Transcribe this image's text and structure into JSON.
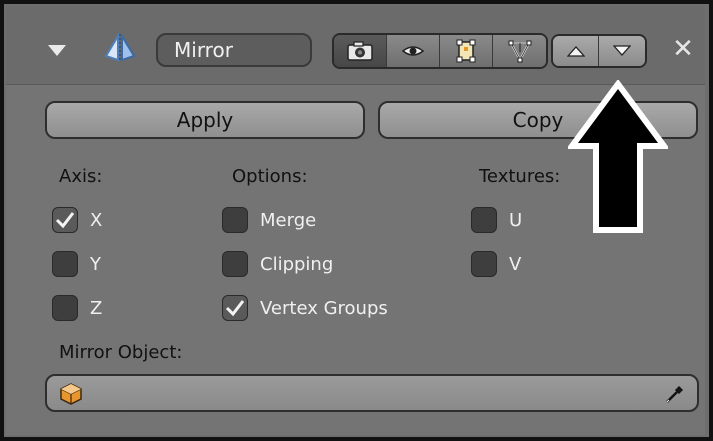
{
  "header": {
    "modifier_name": "Mirror",
    "toggles": [
      {
        "icon": "camera-icon",
        "active": true
      },
      {
        "icon": "eye-icon",
        "active": false
      },
      {
        "icon": "editmode-icon",
        "active": false
      },
      {
        "icon": "vertex-cage-icon",
        "active": false
      }
    ],
    "move_buttons": [
      "move-up-icon",
      "move-down-icon"
    ],
    "close": "✕"
  },
  "actions": {
    "apply_label": "Apply",
    "copy_label": "Copy"
  },
  "columns": {
    "axis": {
      "label": "Axis:",
      "items": [
        {
          "label": "X",
          "checked": true
        },
        {
          "label": "Y",
          "checked": false
        },
        {
          "label": "Z",
          "checked": false
        }
      ]
    },
    "options": {
      "label": "Options:",
      "items": [
        {
          "label": "Merge",
          "checked": false
        },
        {
          "label": "Clipping",
          "checked": false
        },
        {
          "label": "Vertex Groups",
          "checked": true
        }
      ]
    },
    "textures": {
      "label": "Textures:",
      "items": [
        {
          "label": "U",
          "checked": false
        },
        {
          "label": "V",
          "checked": false
        }
      ]
    }
  },
  "mirror_object": {
    "label": "Mirror Object:",
    "value": ""
  },
  "colors": {
    "panel_bg": "#747474",
    "header_bg": "#6b6b6b",
    "button_bg": "#9d9d9d",
    "checkbox_bg": "#3e3e3e",
    "annotation_arrow": "#000000"
  }
}
